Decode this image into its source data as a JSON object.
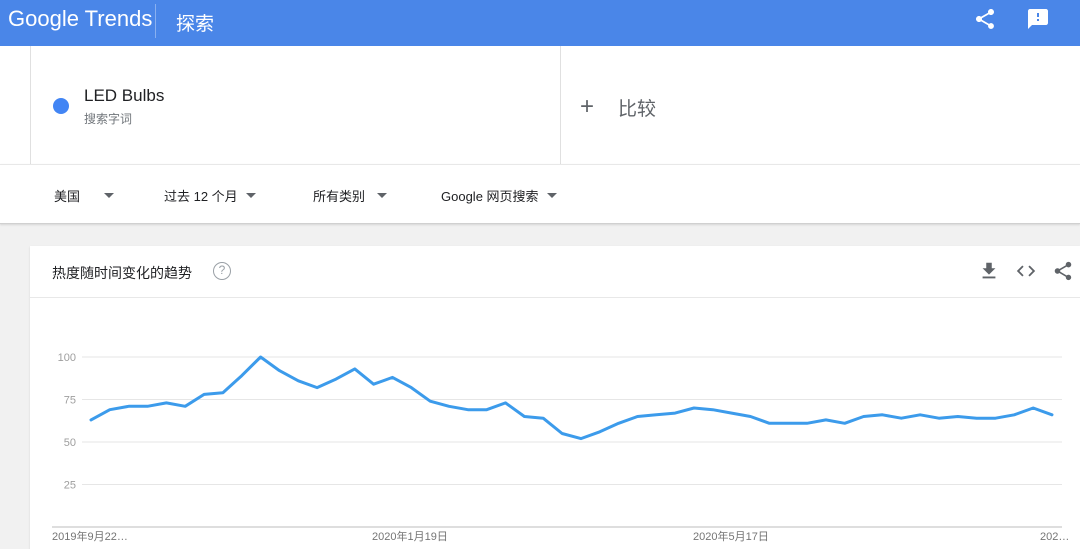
{
  "header": {
    "logo_google": "Google",
    "logo_trends": "Trends",
    "title": "探索",
    "share_icon": "share-icon",
    "feedback_icon": "feedback-icon",
    "bar_color": "#4a86e8"
  },
  "search": {
    "term": "LED Bulbs",
    "term_type": "搜索字词",
    "term_color": "#4285f4",
    "compare_label": "比较"
  },
  "filters": {
    "region": "美国",
    "time_range": "过去 12 个月",
    "category": "所有类别",
    "search_type": "Google 网页搜索"
  },
  "card": {
    "title": "热度随时间变化的趋势",
    "help_icon": "help-icon",
    "download_icon": "download-icon",
    "embed_icon": "embed-icon",
    "share_icon": "share-icon"
  },
  "chart_data": {
    "type": "line",
    "series": [
      {
        "color": "#3c9beb",
        "values": [
          63,
          69,
          71,
          71,
          73,
          71,
          78,
          79,
          89,
          100,
          92,
          86,
          82,
          87,
          93,
          84,
          88,
          82,
          74,
          71,
          69,
          69,
          73,
          65,
          64,
          55,
          52,
          56,
          61,
          65,
          66,
          67,
          70,
          69,
          67,
          65,
          61,
          61,
          61,
          63,
          61,
          65,
          66,
          64,
          66,
          64,
          65,
          64,
          64,
          66,
          70,
          66
        ]
      }
    ],
    "yticks": [
      25,
      50,
      75,
      100
    ],
    "ylim": [
      0,
      100
    ],
    "xtick_labels": [
      "2019年9月22…",
      "2020年1月19日",
      "2020年5月17日",
      "202…"
    ],
    "grid": true
  }
}
